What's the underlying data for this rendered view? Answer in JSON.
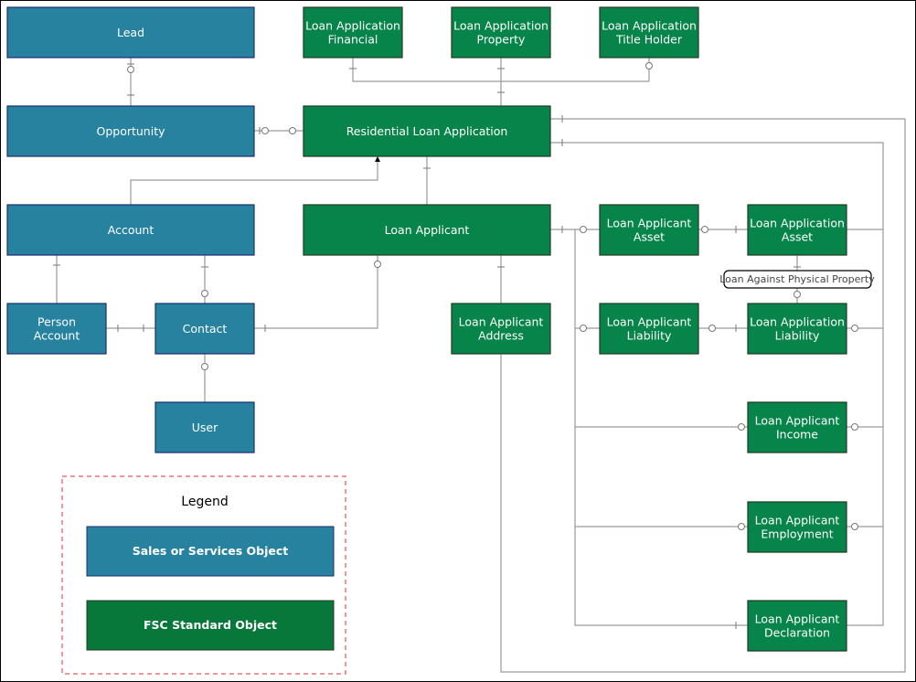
{
  "colors": {
    "sales_object": "#26829f",
    "sales_border": "#1c2f70",
    "fsc_object": "#07844a",
    "fsc_border": "#1f3b22",
    "legend_fsc": "#08773a",
    "legend_border": "#e03030",
    "line": "#9a9a9a"
  },
  "entities": {
    "lead": {
      "lines": [
        "Lead"
      ],
      "kind": "sales"
    },
    "opportunity": {
      "lines": [
        "Opportunity"
      ],
      "kind": "sales"
    },
    "account": {
      "lines": [
        "Account"
      ],
      "kind": "sales"
    },
    "person_account": {
      "lines": [
        "Person",
        "Account"
      ],
      "kind": "sales"
    },
    "contact": {
      "lines": [
        "Contact"
      ],
      "kind": "sales"
    },
    "user": {
      "lines": [
        "User"
      ],
      "kind": "sales"
    },
    "loan_application_financial": {
      "lines": [
        "Loan Application",
        "Financial"
      ],
      "kind": "fsc"
    },
    "loan_application_property": {
      "lines": [
        "Loan Application",
        "Property"
      ],
      "kind": "fsc"
    },
    "loan_application_title_holder": {
      "lines": [
        "Loan Application",
        "Title Holder"
      ],
      "kind": "fsc"
    },
    "residential_loan_application": {
      "lines": [
        "Residential Loan Application"
      ],
      "kind": "fsc"
    },
    "loan_applicant": {
      "lines": [
        "Loan Applicant"
      ],
      "kind": "fsc"
    },
    "loan_applicant_address": {
      "lines": [
        "Loan Applicant",
        "Address"
      ],
      "kind": "fsc"
    },
    "loan_applicant_asset": {
      "lines": [
        "Loan Applicant",
        "Asset"
      ],
      "kind": "fsc"
    },
    "loan_application_asset": {
      "lines": [
        "Loan Application",
        "Asset"
      ],
      "kind": "fsc"
    },
    "loan_applicant_liability": {
      "lines": [
        "Loan Applicant",
        "Liability"
      ],
      "kind": "fsc"
    },
    "loan_application_liability": {
      "lines": [
        "Loan Application",
        "Liability"
      ],
      "kind": "fsc"
    },
    "loan_applicant_income": {
      "lines": [
        "Loan Applicant",
        "Income"
      ],
      "kind": "fsc"
    },
    "loan_applicant_employment": {
      "lines": [
        "Loan Applicant",
        "Employment"
      ],
      "kind": "fsc"
    },
    "loan_applicant_declaration": {
      "lines": [
        "Loan Applicant",
        "Declaration"
      ],
      "kind": "fsc"
    }
  },
  "relationship_label": "Loan Against Physical Property",
  "legend": {
    "title": "Legend",
    "sales": "Sales or Services Object",
    "fsc": "FSC Standard Object"
  }
}
